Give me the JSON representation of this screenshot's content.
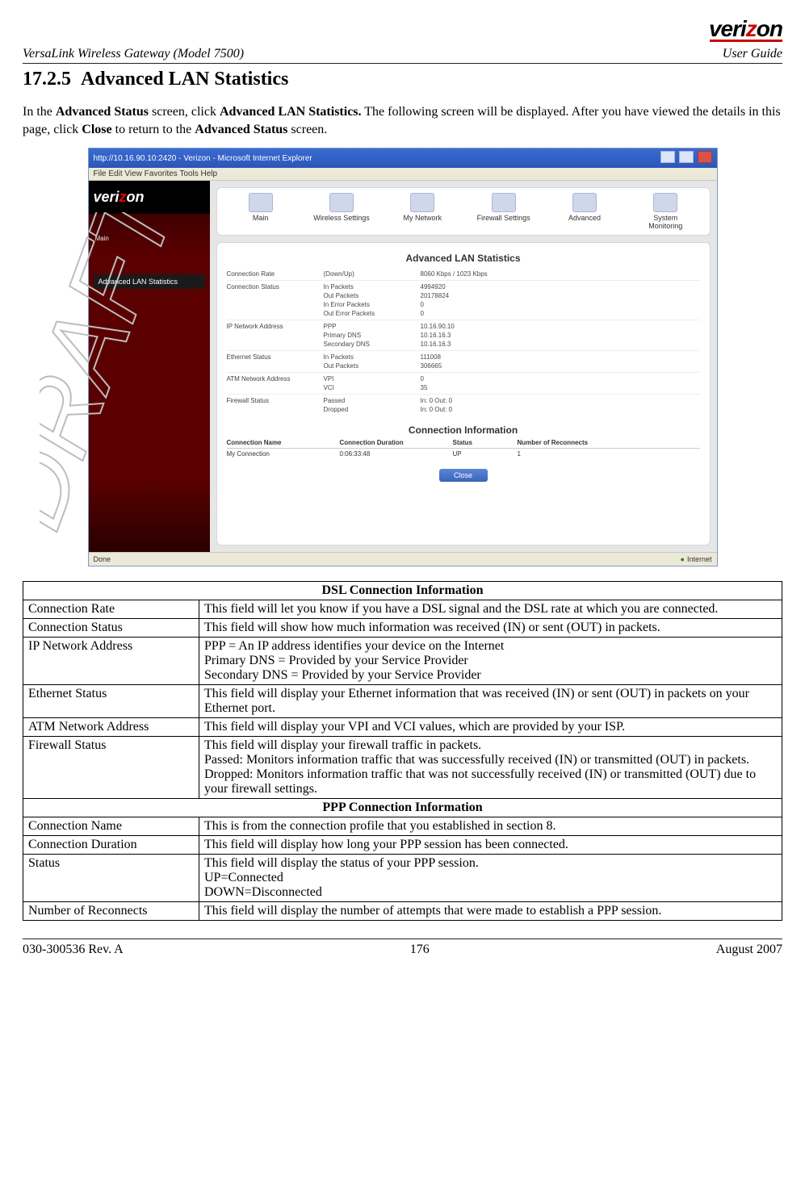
{
  "logo_text": "verizon",
  "running_head_left": "VersaLink Wireless Gateway (Model 7500)",
  "running_head_right": "User Guide",
  "section_number": "17.2.5",
  "section_title": "Advanced LAN Statistics",
  "intro_parts": {
    "p1": "In the ",
    "b1": "Advanced Status",
    "p2": " screen, click ",
    "b2": "Advanced LAN Statistics.",
    "p3": " The following screen will be displayed. After you have viewed the details in this page, click ",
    "b3": "Close",
    "p4": " to return to the ",
    "b4": "Advanced Status",
    "p5": " screen."
  },
  "screenshot": {
    "titlebar": "http://10.16.90.10:2420 - Verizon - Microsoft Internet Explorer",
    "menubar": "File   Edit   View   Favorites   Tools   Help",
    "side_tab": "Advanced LAN Statistics",
    "breadcrumb": "Main",
    "nav": [
      "Main",
      "Wireless Settings",
      "My Network",
      "Firewall Settings",
      "Advanced",
      "System Monitoring"
    ],
    "card_title": "Advanced LAN Statistics",
    "stats": [
      {
        "l": "Connection Rate",
        "m": "(Down/Up)",
        "r": "8060 Kbps / 1023 Kbps"
      },
      {
        "l": "Connection Status",
        "m": "In Packets",
        "r": "4994920"
      },
      {
        "l": "",
        "m": "Out Packets",
        "r": "20178824"
      },
      {
        "l": "",
        "m": "In Error Packets",
        "r": "0"
      },
      {
        "l": "",
        "m": "Out Error Packets",
        "r": "0"
      },
      {
        "l": "IP Network Address",
        "m": "PPP",
        "r": "10.16.90.10"
      },
      {
        "l": "",
        "m": "Primary DNS",
        "r": "10.16.16.3"
      },
      {
        "l": "",
        "m": "Secondary DNS",
        "r": "10.16.16.3"
      },
      {
        "l": "Ethernet Status",
        "m": "In Packets",
        "r": "111008"
      },
      {
        "l": "",
        "m": "Out Packets",
        "r": "306665"
      },
      {
        "l": "ATM Network Address",
        "m": "VPI",
        "r": "0"
      },
      {
        "l": "",
        "m": "VCI",
        "r": "35"
      },
      {
        "l": "Firewall Status",
        "m": "Passed",
        "r": "In: 0   Out: 0"
      },
      {
        "l": "",
        "m": "Dropped",
        "r": "In: 0   Out: 0"
      }
    ],
    "conn_title": "Connection Information",
    "conn_headers": [
      "Connection Name",
      "Connection Duration",
      "Status",
      "Number of Reconnects"
    ],
    "conn_row": [
      "My Connection",
      "0:06:33:48",
      "UP",
      "1"
    ],
    "close_button": "Close",
    "status_left": "Done",
    "status_right": "Internet"
  },
  "table": {
    "h1": "DSL Connection Information",
    "rows1": [
      {
        "label": "Connection Rate",
        "desc": "This field will let you know if you have a DSL signal and the DSL rate at which you are connected."
      },
      {
        "label": "Connection Status",
        "desc": "This field will show how much information was received (IN) or sent (OUT) in packets."
      },
      {
        "label": "IP Network Address",
        "desc_lines": [
          "PPP = An IP address identifies your device on the Internet",
          "Primary DNS = Provided by your Service Provider",
          "Secondary DNS = Provided by your Service Provider"
        ]
      },
      {
        "label": "Ethernet Status",
        "desc": "This field will display your Ethernet information that was received (IN) or sent (OUT) in packets on your Ethernet port."
      },
      {
        "label": "ATM Network Address",
        "desc": "This field will display your VPI and VCI values, which are provided by your ISP."
      },
      {
        "label": "Firewall Status",
        "desc_lines": [
          "This field will display your firewall traffic in packets.",
          "Passed: Monitors information traffic that was successfully received (IN) or transmitted (OUT) in packets.",
          "Dropped: Monitors information traffic that was not successfully received (IN) or transmitted (OUT) due to your firewall settings."
        ]
      }
    ],
    "h2": "PPP Connection Information",
    "rows2": [
      {
        "label": "Connection Name",
        "desc": "This is from the connection profile that you established in section 8."
      },
      {
        "label": "Connection Duration",
        "desc": "This field will display how long your PPP session has been connected."
      },
      {
        "label": "Status",
        "desc_lines": [
          "This field will display the status of your PPP session.",
          "UP=Connected",
          "DOWN=Disconnected"
        ]
      },
      {
        "label": "Number of Reconnects",
        "desc": "This field will display the number of attempts that were made to establish a PPP session."
      }
    ]
  },
  "footer": {
    "left": "030-300536 Rev. A",
    "center": "176",
    "right": "August 2007"
  }
}
